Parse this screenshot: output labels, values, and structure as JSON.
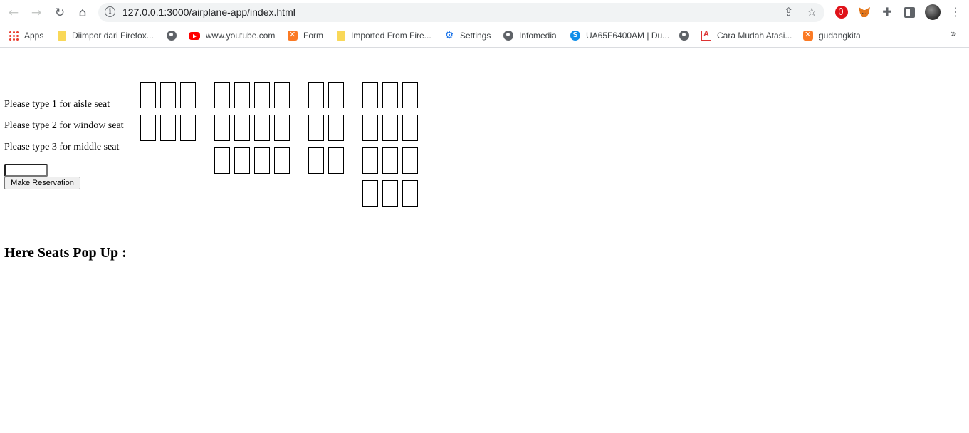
{
  "browser": {
    "url": "127.0.0.1:3000/airplane-app/index.html",
    "bookmarks": [
      {
        "label": "Apps",
        "icon": "apps-grid-icon"
      },
      {
        "label": "Diimpor dari Firefox...",
        "icon": "folder-icon"
      },
      {
        "label": "",
        "icon": "globe-icon"
      },
      {
        "label": "www.youtube.com",
        "icon": "youtube-icon"
      },
      {
        "label": "Form",
        "icon": "xampp-icon"
      },
      {
        "label": "Imported From Fire...",
        "icon": "folder-icon"
      },
      {
        "label": "Settings",
        "icon": "gear-icon"
      },
      {
        "label": "Infomedia",
        "icon": "globe-icon"
      },
      {
        "label": "UA65F6400AM | Du...",
        "icon": "skype-icon"
      },
      {
        "label": "",
        "icon": "globe-icon"
      },
      {
        "label": "Cara Mudah Atasi...",
        "icon": "site-icon"
      },
      {
        "label": "gudangkita",
        "icon": "xampp-icon"
      }
    ],
    "more_symbol": "»"
  },
  "page": {
    "instructions": [
      "Please type 1 for aisle seat",
      "Please type 2 for window seat",
      "Please type 3 for middle seat"
    ],
    "seat_input_value": "",
    "reserve_button": "Make Reservation",
    "heading": "Here Seats Pop Up :"
  },
  "seat_map": {
    "sections": [
      {
        "name": "section-a",
        "rows": [
          3,
          3
        ]
      },
      {
        "name": "section-b",
        "rows": [
          4,
          4,
          4
        ]
      },
      {
        "name": "section-c",
        "rows": [
          2,
          2,
          2
        ]
      },
      {
        "name": "section-d",
        "rows": [
          3,
          3,
          3,
          3
        ]
      }
    ]
  }
}
